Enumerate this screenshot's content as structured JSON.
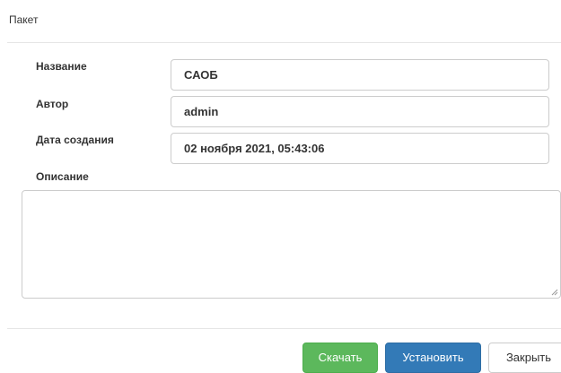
{
  "modal": {
    "title": "Пакет"
  },
  "form": {
    "name": {
      "label": "Название",
      "value": "САОБ"
    },
    "author": {
      "label": "Автор",
      "value": "admin"
    },
    "created": {
      "label": "Дата создания",
      "value": "02 ноября 2021, 05:43:06"
    },
    "description": {
      "label": "Описание",
      "value": ""
    }
  },
  "footer": {
    "download_label": "Скачать",
    "install_label": "Установить",
    "close_label": "Закрыть"
  },
  "colors": {
    "download_button": "#5cb85c",
    "install_button": "#337ab7",
    "close_button": "#ffffff"
  }
}
